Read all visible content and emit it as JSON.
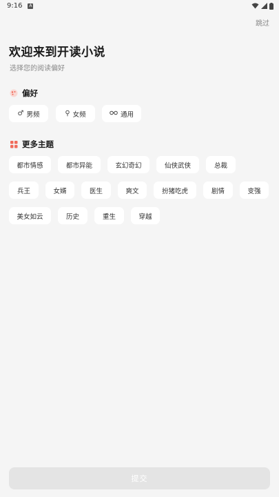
{
  "status": {
    "time": "9:16",
    "notification_glyph": "A"
  },
  "header": {
    "skip": "跳过",
    "title": "欢迎来到开读小说",
    "subtitle": "选择您的阅读偏好"
  },
  "preference": {
    "label": "偏好",
    "icon": "palette-icon",
    "options": [
      {
        "label": "男频",
        "icon": "male-icon"
      },
      {
        "label": "女频",
        "icon": "female-icon"
      },
      {
        "label": "通用",
        "icon": "glasses-icon"
      }
    ]
  },
  "topics": {
    "label": "更多主题",
    "icon": "grid-icon",
    "items": [
      "都市情感",
      "都市异能",
      "玄幻奇幻",
      "仙侠武侠",
      "总裁",
      "兵王",
      "女婿",
      "医生",
      "爽文",
      "扮猪吃虎",
      "剧情",
      "变强",
      "美女如云",
      "历史",
      "重生",
      "穿越"
    ]
  },
  "submit_label": "提交",
  "colors": {
    "accent": "#f06a5a",
    "background": "#f5f5f5",
    "chip": "#ffffff"
  }
}
